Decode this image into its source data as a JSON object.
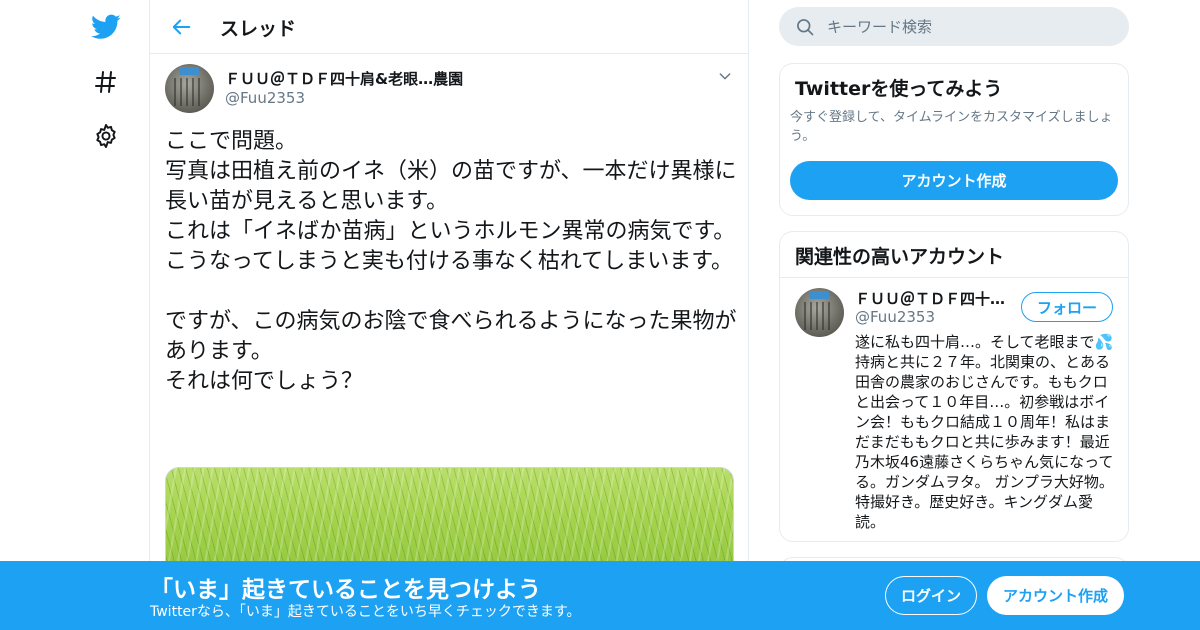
{
  "header": {
    "title": "スレッド"
  },
  "tweet": {
    "author_name": "ＦＵＵ＠ＴＤＦ四十肩&老眼…農園",
    "author_handle": "@Fuu2353",
    "text": "ここで問題。\n写真は田植え前のイネ（米）の苗ですが、一本だけ異様に長い苗が見えると思います。\nこれは「イネばか苗病」というホルモン異常の病気です。\nこうなってしまうと実も付ける事なく枯れてしまいます。\n\nですが、この病気のお陰で食べられるようになった果物があります。\nそれは何でしょう？"
  },
  "search": {
    "placeholder": "キーワード検索"
  },
  "signup_card": {
    "title": "Twitterを使ってみよう",
    "description": "今すぐ登録して、タイムラインをカスタマイズしましょう。",
    "button_label": "アカウント作成"
  },
  "related_card": {
    "title": "関連性の高いアカウント",
    "account": {
      "name": "ＦＵＵ＠ＴＤＦ四十肩&老眼…農園",
      "handle": "@Fuu2353",
      "follow_label": "フォロー",
      "bio": "遂に私も四十肩…。そして老眼まで💦持病と共に２７年。北関東の、とある田舎の農家のおじさんです。ももクロと出会って１０年目…。初参戦はボイン会！ももクロ結成１０周年！私はまだまだももクロと共に歩みます！最近乃木坂46遠藤さくらちゃん気になってる。ガンダムヲタ。 ガンプラ大好物。特撮好き。歴史好き。キングダム愛読。"
    }
  },
  "bottom_bar": {
    "title": "「いま」起きていることを見つけよう",
    "subtitle": "Twitterなら、「いま」起きていることをいち早くチェックできます。",
    "login_label": "ログイン",
    "signup_label": "アカウント作成"
  },
  "colors": {
    "accent": "#1da1f2",
    "text": "#14171a",
    "secondary": "#657786",
    "border": "#e6ecf0"
  },
  "icons": [
    "twitter-logo-icon",
    "hashtag-icon",
    "gear-icon",
    "back-arrow-icon",
    "chevron-down-icon",
    "search-icon"
  ]
}
